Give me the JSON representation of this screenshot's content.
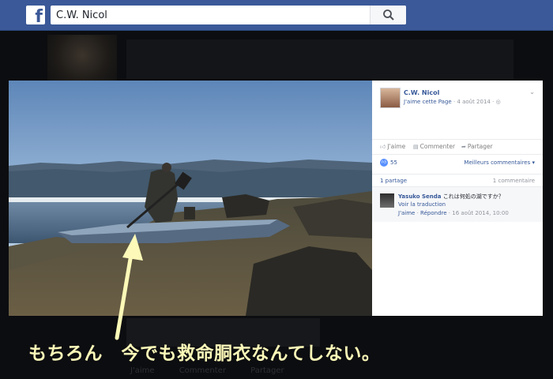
{
  "header": {
    "logo": "f",
    "search_value": "C.W. Nicol",
    "search_icon": "magnifier-icon"
  },
  "background": {
    "actions": [
      "J'aime",
      "Commenter",
      "Partager"
    ]
  },
  "panel": {
    "page_name": "C.W. Nicol",
    "like_page": "J'aime cette Page",
    "date": "4 août 2014",
    "audience_icon": "globe-icon",
    "actions": {
      "like": "J'aime",
      "comment": "Commenter",
      "share": "Partager"
    },
    "likes_count": "55",
    "best_comments": "Meilleurs commentaires",
    "shares": "1 partage",
    "comments_count": "1 commentaire",
    "comment": {
      "author": "Yasuko Senda",
      "text": "これは何処の湖ですか？",
      "translate": "Voir la traduction",
      "like": "J'aime",
      "reply": "Répondre",
      "timestamp": "16 août 2014, 10:00"
    }
  },
  "overlay": {
    "caption": "もちろん　今でも救命胴衣なんてしない。",
    "arrow_color": "#fdf9b8"
  }
}
